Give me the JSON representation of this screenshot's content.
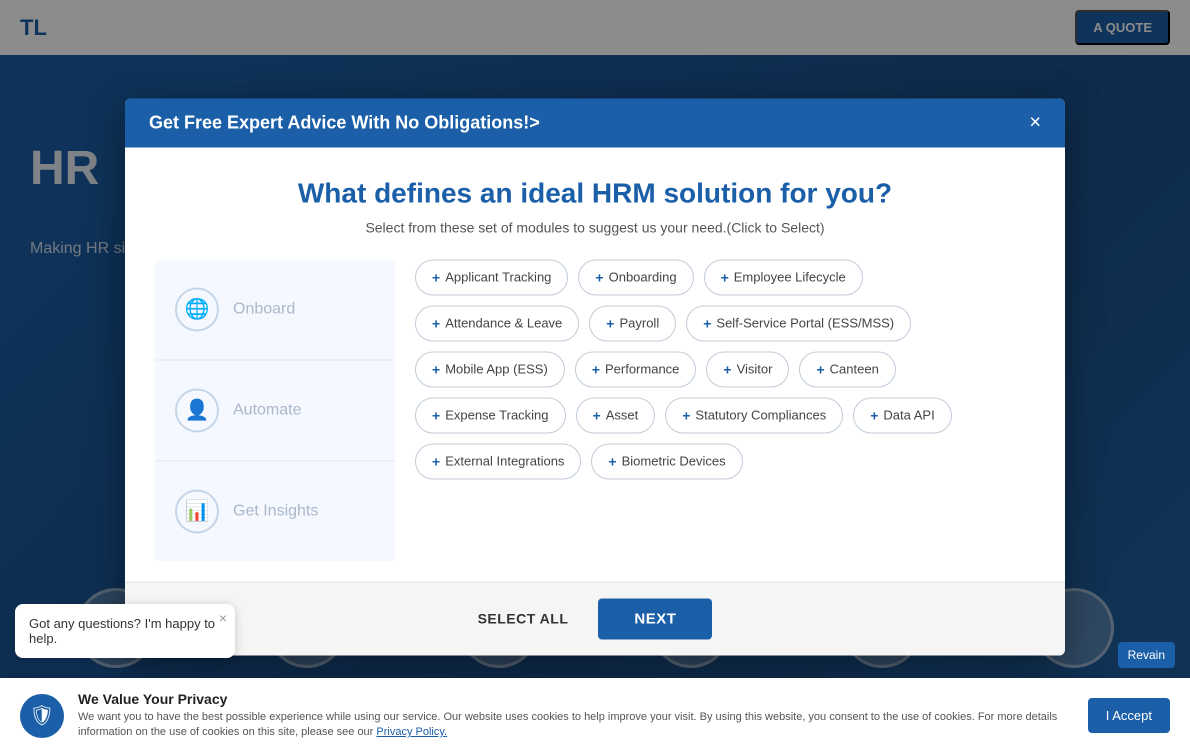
{
  "navbar": {
    "logo": "TL",
    "quote_button": "A QUOTE"
  },
  "background": {
    "hr_text": "HR",
    "sub_text": "Making HR simple and powerful"
  },
  "modal": {
    "header_text": "Get Free Expert Advice With No Obligations!>",
    "close_label": "×",
    "main_title": "What defines an ideal HRM solution for you?",
    "subtitle": "Select from these set of modules to suggest us your need.(Click to Select)",
    "left_panel": [
      {
        "label": "Onboard",
        "icon": "🌐"
      },
      {
        "label": "Automate",
        "icon": "👤"
      },
      {
        "label": "Get Insights",
        "icon": "📊"
      }
    ],
    "chips": [
      {
        "id": "applicant-tracking",
        "label": "Applicant Tracking",
        "selected": false
      },
      {
        "id": "onboarding",
        "label": "Onboarding",
        "selected": false
      },
      {
        "id": "employee-lifecycle",
        "label": "Employee Lifecycle",
        "selected": false
      },
      {
        "id": "attendance-leave",
        "label": "Attendance & Leave",
        "selected": false
      },
      {
        "id": "payroll",
        "label": "Payroll",
        "selected": false
      },
      {
        "id": "self-service-portal",
        "label": "Self-Service Portal (ESS/MSS)",
        "selected": false
      },
      {
        "id": "mobile-app",
        "label": "Mobile App (ESS)",
        "selected": false
      },
      {
        "id": "performance",
        "label": "Performance",
        "selected": false
      },
      {
        "id": "visitor",
        "label": "Visitor",
        "selected": false
      },
      {
        "id": "canteen",
        "label": "Canteen",
        "selected": false
      },
      {
        "id": "expense-tracking",
        "label": "Expense Tracking",
        "selected": false
      },
      {
        "id": "asset",
        "label": "Asset",
        "selected": false
      },
      {
        "id": "statutory-compliances",
        "label": "Statutory Compliances",
        "selected": false
      },
      {
        "id": "data-api",
        "label": "Data API",
        "selected": false
      },
      {
        "id": "external-integrations",
        "label": "External Integrations",
        "selected": false
      },
      {
        "id": "biometric-devices",
        "label": "Biometric Devices",
        "selected": false
      }
    ],
    "footer": {
      "select_all": "SELECT ALL",
      "next": "NEXT"
    }
  },
  "chat_bubble": {
    "text": "Got any questions? I'm happy to help.",
    "close": "×"
  },
  "privacy": {
    "title": "We Value Your Privacy",
    "body": "We want you to have the best possible experience while using our service. Our website uses cookies to help improve your visit. By using this website, you consent to the use of cookies. For more details information on the use of cookies on this site, please see our",
    "link_text": "Privacy Policy.",
    "accept_button": "I Accept"
  },
  "revain": {
    "label": "Revain"
  }
}
